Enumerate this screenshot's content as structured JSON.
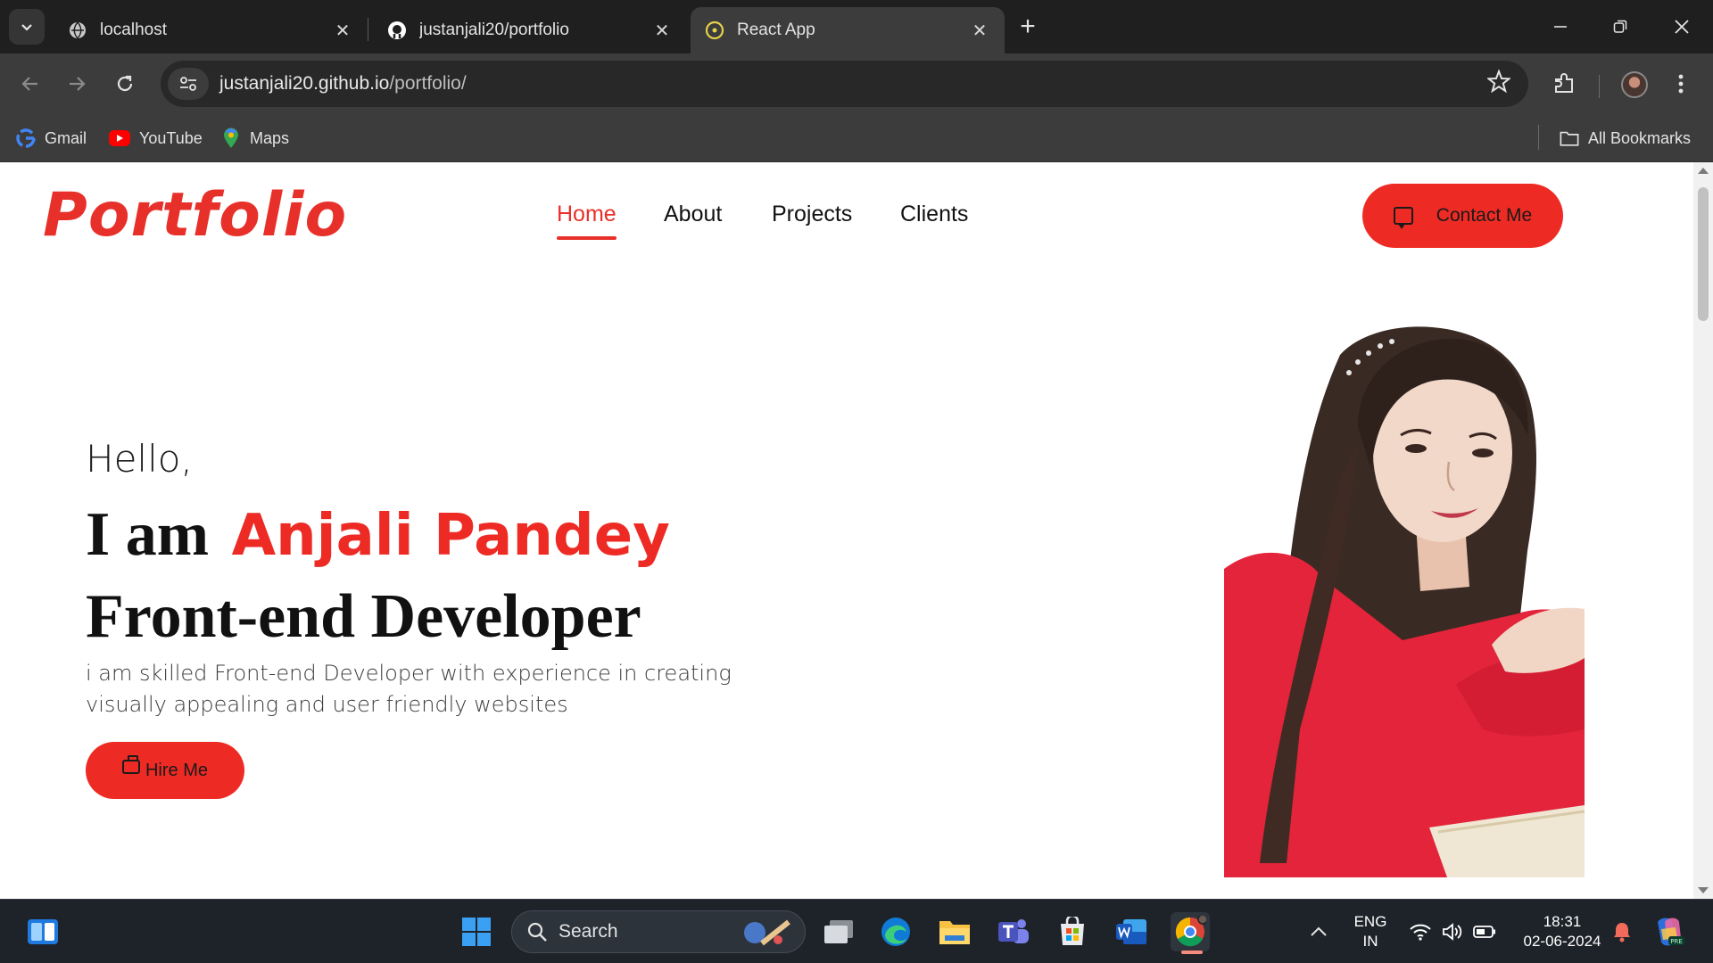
{
  "browser": {
    "tabs": [
      {
        "title": "localhost",
        "active": false,
        "favicon": "globe-icon"
      },
      {
        "title": "justanjali20/portfolio",
        "active": false,
        "favicon": "github-icon"
      },
      {
        "title": "React App",
        "active": true,
        "favicon": "react-icon"
      }
    ],
    "url_host": "justanjali20.github.io",
    "url_path": "/portfolio/",
    "bookmarks": [
      {
        "label": "Gmail",
        "icon": "google-icon"
      },
      {
        "label": "YouTube",
        "icon": "youtube-icon"
      },
      {
        "label": "Maps",
        "icon": "maps-icon"
      }
    ],
    "all_bookmarks_label": "All Bookmarks"
  },
  "page": {
    "logo": "Portfolio",
    "nav": [
      {
        "label": "Home",
        "active": true
      },
      {
        "label": "About",
        "active": false
      },
      {
        "label": "Projects",
        "active": false
      },
      {
        "label": "Clients",
        "active": false
      }
    ],
    "contact_button": "Contact Me",
    "hero": {
      "greeting": "Hello,",
      "intro_prefix": "I am",
      "name": "Anjali Pandey",
      "role": "Front-end Developer",
      "description": "i am skilled Front-end Developer with experience in creating visually appealing and user friendly websites",
      "hire_button": "Hire Me"
    }
  },
  "taskbar": {
    "search_placeholder": "Search",
    "language": "ENG",
    "region": "IN",
    "time": "18:31",
    "date": "02-06-2024"
  },
  "colors": {
    "accent": "#ed2b24",
    "chrome_dark": "#1f1f1f",
    "chrome_toolbar": "#3c3c3c",
    "taskbar": "#1e2329"
  }
}
